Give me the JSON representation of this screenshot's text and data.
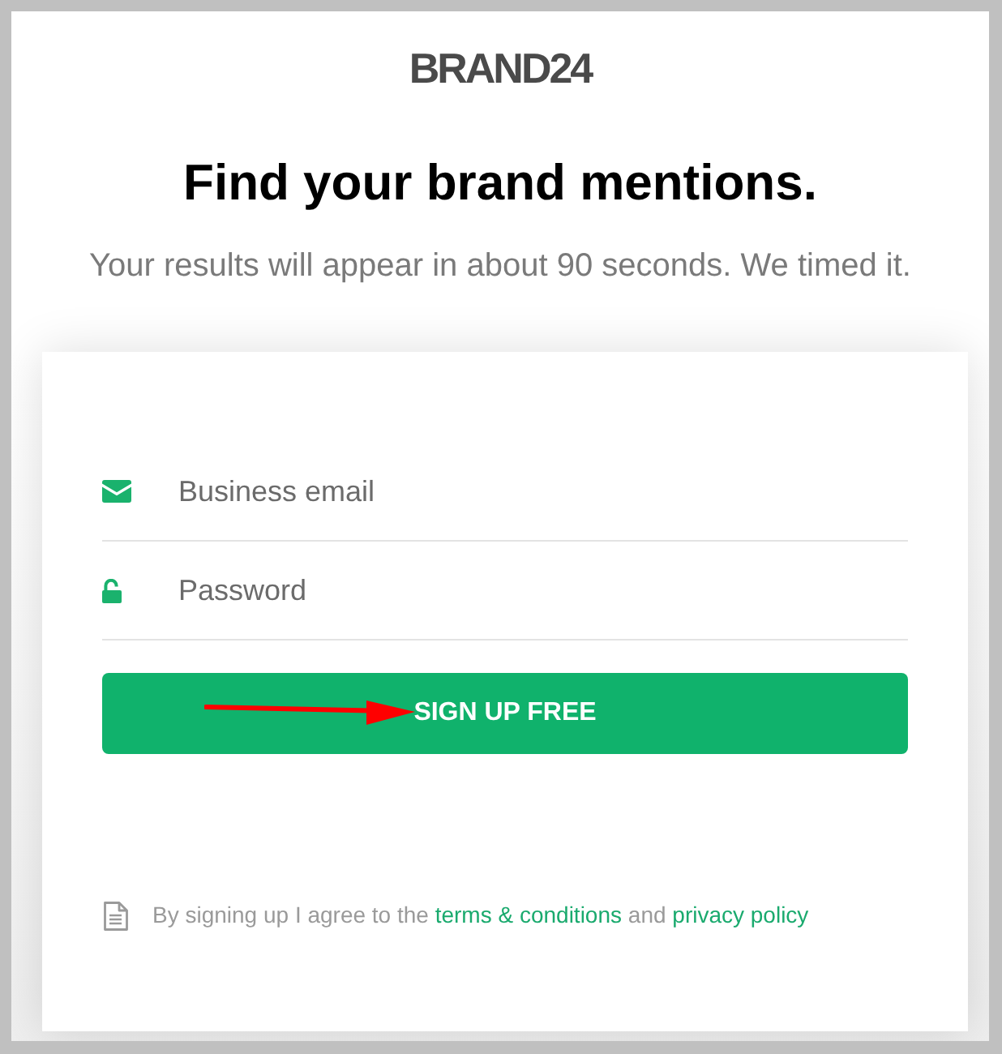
{
  "logo": {
    "text": "BRAND24"
  },
  "headline": "Find your brand mentions.",
  "subtitle": "Your results will appear in about 90 seconds. We timed it.",
  "form": {
    "fields": [
      {
        "kind": "email",
        "placeholder": "Business email"
      },
      {
        "kind": "password",
        "placeholder": "Password"
      }
    ],
    "submit_button": {
      "label": "SIGN UP FREE"
    },
    "annotations": [
      {
        "kind": "arrow"
      }
    ],
    "agreement": [
      {
        "kind": "text",
        "text": "By signing up I agree to the"
      },
      {
        "kind": "link",
        "text": "terms & conditions"
      },
      {
        "kind": "text",
        "text": "and"
      },
      {
        "kind": "link",
        "text": "privacy policy"
      }
    ]
  }
}
